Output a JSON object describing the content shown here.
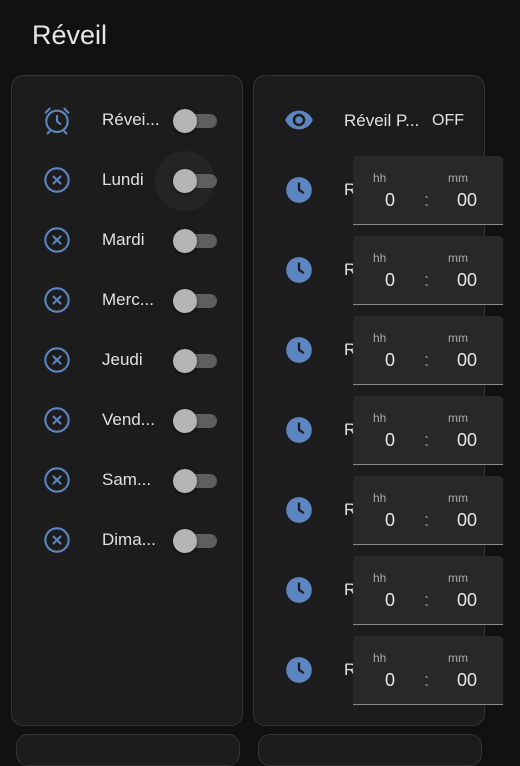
{
  "page": {
    "title": "Réveil"
  },
  "colors": {
    "accent": "#5d86c0",
    "background": "#111111",
    "card": "#1c1c1c"
  },
  "left_card": {
    "rows": [
      {
        "icon": "alarm-clock-icon",
        "label": "Révei...",
        "toggle": false
      },
      {
        "icon": "close-circle-icon",
        "label": "Lundi",
        "toggle": false
      },
      {
        "icon": "close-circle-icon",
        "label": "Mardi",
        "toggle": false
      },
      {
        "icon": "close-circle-icon",
        "label": "Merc...",
        "toggle": false
      },
      {
        "icon": "close-circle-icon",
        "label": "Jeudi",
        "toggle": false
      },
      {
        "icon": "close-circle-icon",
        "label": "Vend...",
        "toggle": false
      },
      {
        "icon": "close-circle-icon",
        "label": "Sam...",
        "toggle": false
      },
      {
        "icon": "close-circle-icon",
        "label": "Dima...",
        "toggle": false
      }
    ]
  },
  "right_card": {
    "header": {
      "icon": "eye-icon",
      "label": "Réveil P...",
      "state": "OFF"
    },
    "time_rows": [
      {
        "icon": "clock-icon",
        "label": "R",
        "hh_label": "hh",
        "mm_label": "mm",
        "hours": "0",
        "separator": ":",
        "minutes": "00"
      },
      {
        "icon": "clock-icon",
        "label": "R",
        "hh_label": "hh",
        "mm_label": "mm",
        "hours": "0",
        "separator": ":",
        "minutes": "00"
      },
      {
        "icon": "clock-icon",
        "label": "R",
        "hh_label": "hh",
        "mm_label": "mm",
        "hours": "0",
        "separator": ":",
        "minutes": "00"
      },
      {
        "icon": "clock-icon",
        "label": "R",
        "hh_label": "hh",
        "mm_label": "mm",
        "hours": "0",
        "separator": ":",
        "minutes": "00"
      },
      {
        "icon": "clock-icon",
        "label": "R",
        "hh_label": "hh",
        "mm_label": "mm",
        "hours": "0",
        "separator": ":",
        "minutes": "00"
      },
      {
        "icon": "clock-icon",
        "label": "R",
        "hh_label": "hh",
        "mm_label": "mm",
        "hours": "0",
        "separator": ":",
        "minutes": "00"
      },
      {
        "icon": "clock-icon",
        "label": "R",
        "hh_label": "hh",
        "mm_label": "mm",
        "hours": "0",
        "separator": ":",
        "minutes": "00"
      }
    ]
  }
}
